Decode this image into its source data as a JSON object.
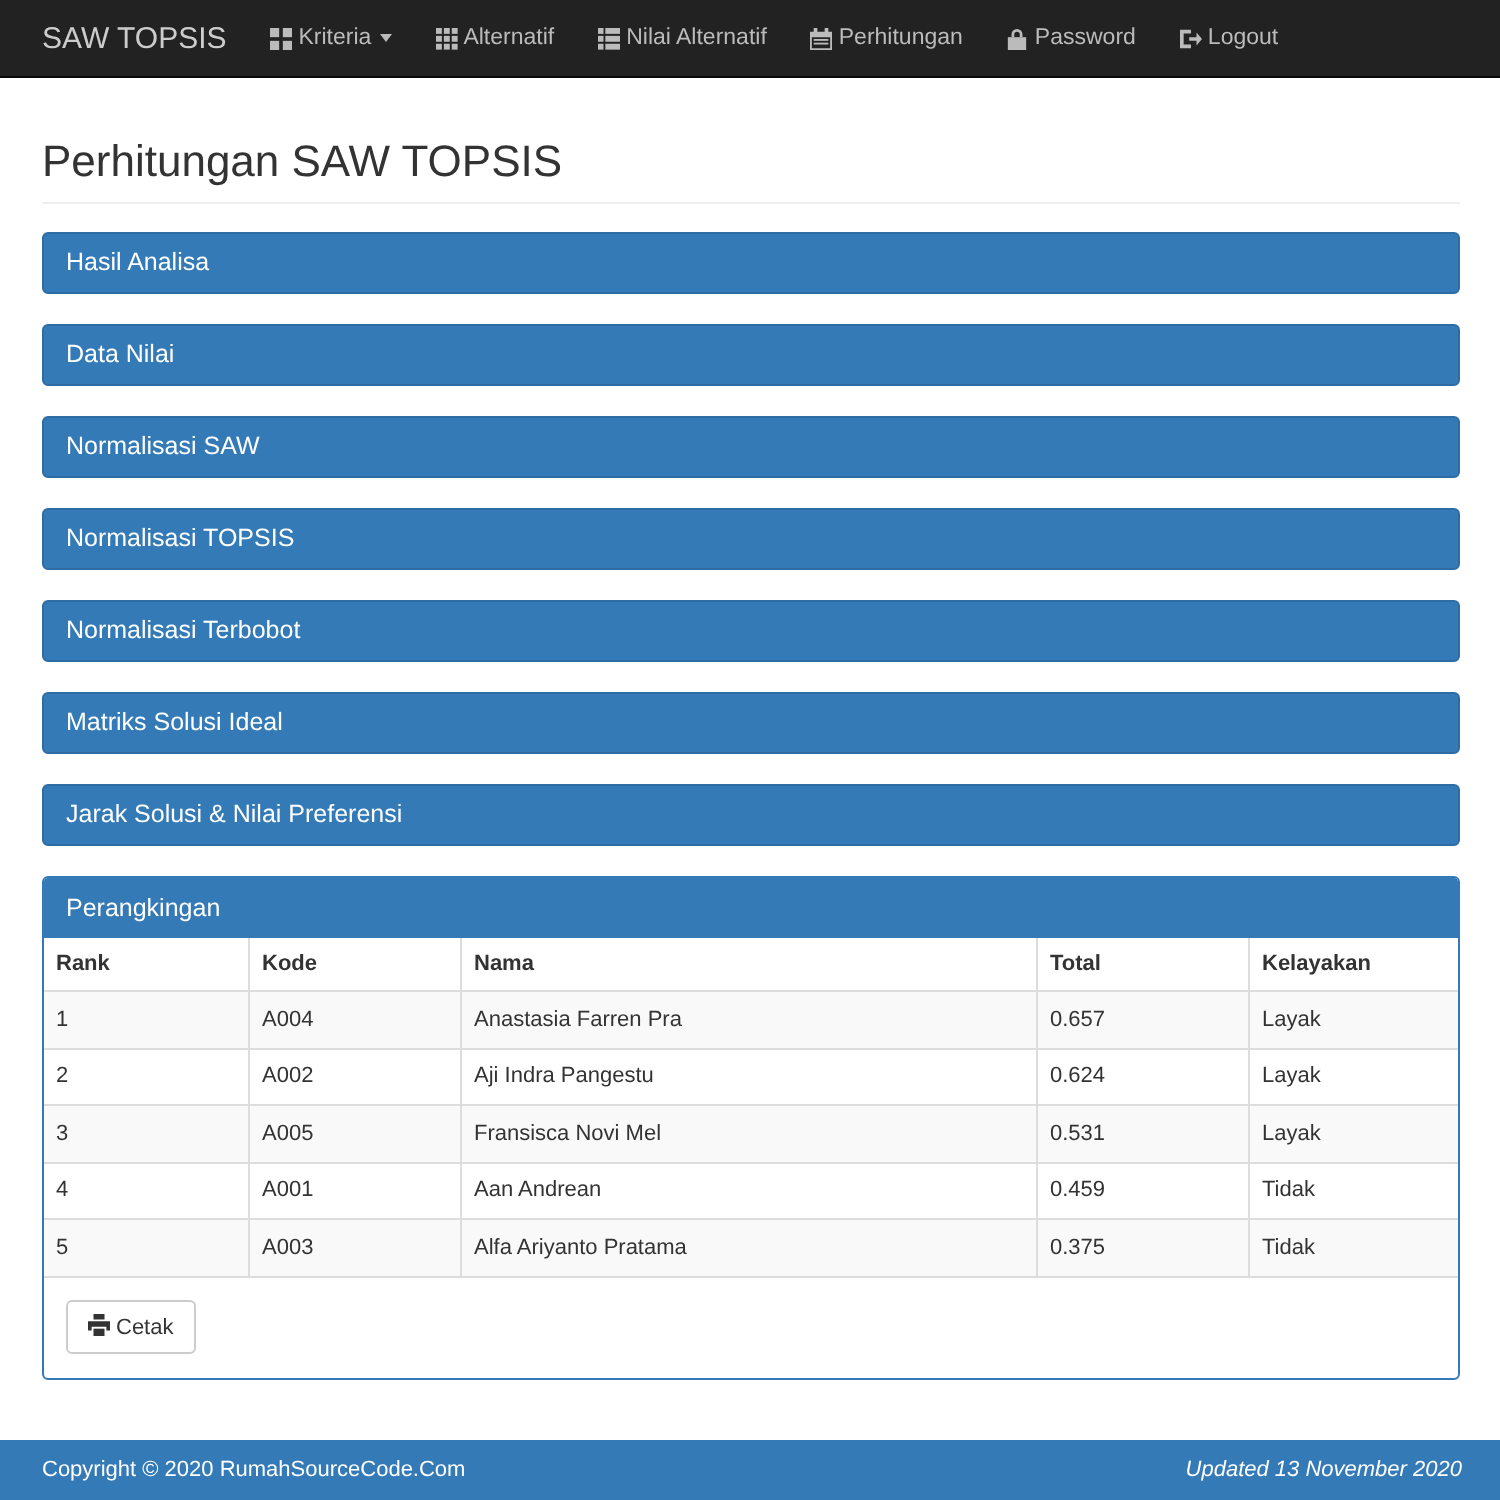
{
  "navbar": {
    "brand": "SAW TOPSIS",
    "items": [
      {
        "label": "Kriteria",
        "dropdown": true
      },
      {
        "label": "Alternatif",
        "dropdown": false
      },
      {
        "label": "Nilai Alternatif",
        "dropdown": false
      },
      {
        "label": "Perhitungan",
        "dropdown": false
      },
      {
        "label": "Password",
        "dropdown": false
      },
      {
        "label": "Logout",
        "dropdown": false
      }
    ]
  },
  "page_title": "Perhitungan SAW TOPSIS",
  "panels": [
    {
      "title": "Hasil Analisa"
    },
    {
      "title": "Data Nilai"
    },
    {
      "title": "Normalisasi SAW"
    },
    {
      "title": "Normalisasi TOPSIS"
    },
    {
      "title": "Normalisasi Terbobot"
    },
    {
      "title": "Matriks Solusi Ideal"
    },
    {
      "title": "Jarak Solusi & Nilai Preferensi"
    }
  ],
  "ranking": {
    "title": "Perangkingan",
    "columns": [
      "Rank",
      "Kode",
      "Nama",
      "Total",
      "Kelayakan"
    ],
    "rows": [
      [
        "1",
        "A004",
        "Anastasia Farren Pra",
        "0.657",
        "Layak"
      ],
      [
        "2",
        "A002",
        "Aji Indra Pangestu",
        "0.624",
        "Layak"
      ],
      [
        "3",
        "A005",
        "Fransisca Novi Mel",
        "0.531",
        "Layak"
      ],
      [
        "4",
        "A001",
        "Aan Andrean",
        "0.459",
        "Tidak"
      ],
      [
        "5",
        "A003",
        "Alfa Ariyanto Pratama",
        "0.375",
        "Tidak"
      ]
    ],
    "button": {
      "label": "Cetak"
    }
  },
  "footer": {
    "copyright": "Copyright © 2020 RumahSourceCode.Com",
    "updated": "Updated 13 November 2020"
  }
}
